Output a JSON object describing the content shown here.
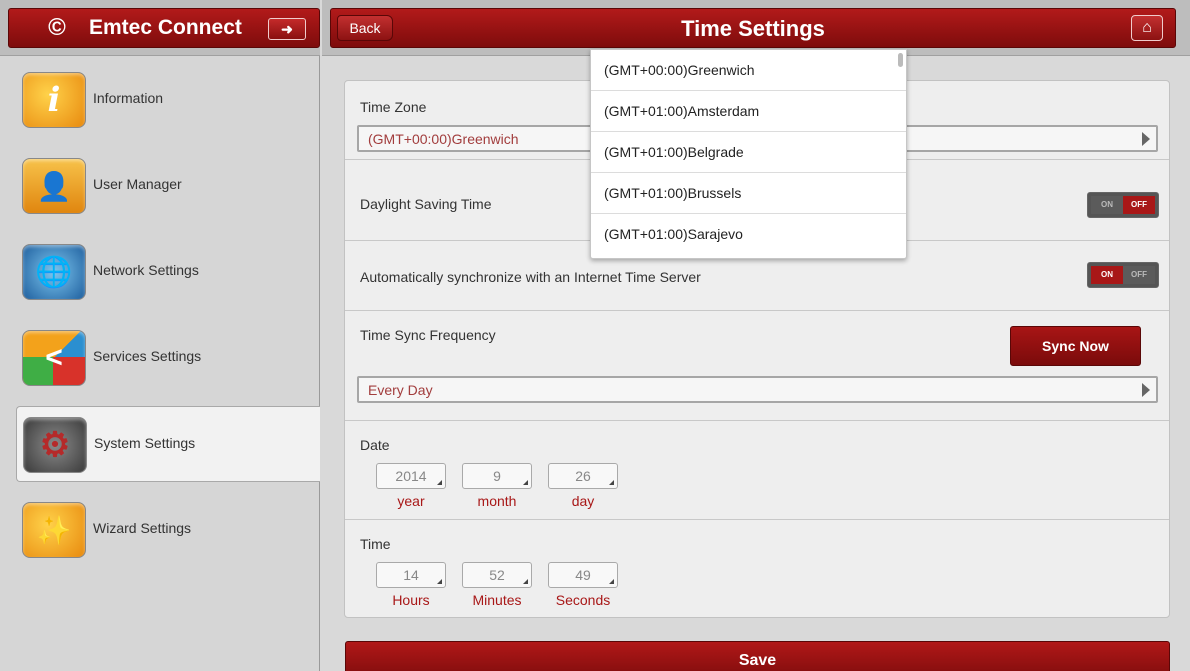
{
  "app": {
    "title": "Emtec Connect",
    "logo_glyph": "©",
    "logout_glyph": "➜"
  },
  "nav": {
    "items": [
      {
        "label": "Information",
        "icon": "info-icon",
        "glyph": "i",
        "color": "#f2a01e"
      },
      {
        "label": "User Manager",
        "icon": "user-icon",
        "glyph": "👤",
        "color": "#f0a321"
      },
      {
        "label": "Network Settings",
        "icon": "globe-icon",
        "glyph": "🌐",
        "color": "#2f79b9"
      },
      {
        "label": "Services Settings",
        "icon": "share-icon",
        "glyph": "<",
        "color": "#3aa64a"
      },
      {
        "label": "System Settings",
        "icon": "gear-icon",
        "glyph": "⚙",
        "color": "#555555"
      },
      {
        "label": "Wizard Settings",
        "icon": "wand-icon",
        "glyph": "✨",
        "color": "#f0a321"
      }
    ],
    "active_index": 4
  },
  "header": {
    "back_label": "Back",
    "title": "Time Settings",
    "home_glyph": "⌂"
  },
  "time_zone": {
    "label": "Time Zone",
    "value": "(GMT+00:00)Greenwich",
    "options": [
      "(GMT+00:00)Greenwich",
      "(GMT+01:00)Amsterdam",
      "(GMT+01:00)Belgrade",
      "(GMT+01:00)Brussels",
      "(GMT+01:00)Sarajevo"
    ]
  },
  "dst": {
    "label": "Daylight Saving Time",
    "on_label": "ON",
    "off_label": "OFF",
    "state": "off"
  },
  "auto_sync": {
    "label": "Automatically synchronize with an Internet Time Server",
    "on_label": "ON",
    "off_label": "OFF",
    "state": "on"
  },
  "sync_frequency": {
    "label": "Time Sync Frequency",
    "value": "Every Day",
    "sync_now_label": "Sync Now"
  },
  "date": {
    "label": "Date",
    "year": "2014",
    "month": "9",
    "day": "26",
    "year_caption": "year",
    "month_caption": "month",
    "day_caption": "day"
  },
  "time": {
    "label": "Time",
    "hours": "14",
    "minutes": "52",
    "seconds": "49",
    "hours_caption": "Hours",
    "minutes_caption": "Minutes",
    "seconds_caption": "Seconds"
  },
  "save_label": "Save"
}
